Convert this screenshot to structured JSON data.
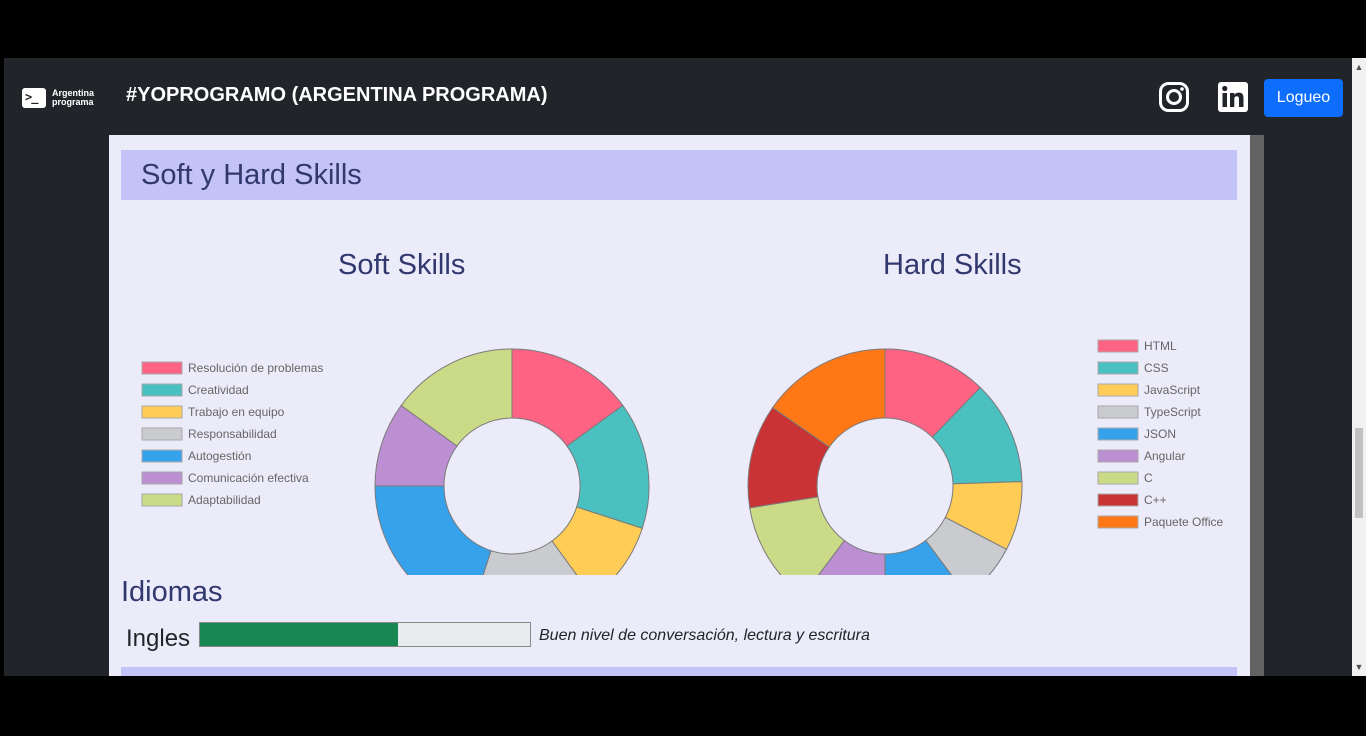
{
  "app": {
    "logo_text_line1": "Argentina",
    "logo_text_line2": "programa",
    "logo_symbol": ">_",
    "title": "#YOPROGRAMO (ARGENTINA PROGRAMA)",
    "login_label": "Logueo",
    "icons": [
      "instagram-icon",
      "linkedin-icon"
    ]
  },
  "section": {
    "title": "Soft y Hard Skills"
  },
  "chart_data": [
    {
      "type": "pie",
      "variant": "doughnut",
      "title": "Soft Skills",
      "legend_position": "left",
      "labels": [
        "Resolución de problemas",
        "Creatividad",
        "Trabajo en equipo",
        "Responsabilidad",
        "Autogestión",
        "Comunicación efectiva",
        "Adaptabilidad"
      ],
      "values": [
        15,
        15,
        10,
        15,
        20,
        10,
        15
      ],
      "colors": [
        "#ff6384",
        "#4bc0c0",
        "#ffcd56",
        "#c9cbcf",
        "#36a2eb",
        "#bb8fd1",
        "#cbda87"
      ]
    },
    {
      "type": "pie",
      "variant": "doughnut",
      "title": "Hard Skills",
      "legend_position": "right",
      "labels": [
        "HTML",
        "CSS",
        "JavaScript",
        "TypeScript",
        "JSON",
        "Angular",
        "C",
        "C++",
        "Paquete Office"
      ],
      "values": [
        12,
        12,
        8,
        7,
        10,
        10,
        12,
        12,
        15
      ],
      "colors": [
        "#ff6384",
        "#4bc0c0",
        "#ffcd56",
        "#c9cbcf",
        "#36a2eb",
        "#bb8fd1",
        "#cbda87",
        "#c93336",
        "#ff7815"
      ]
    }
  ],
  "languages": {
    "title": "Idiomas",
    "items": [
      {
        "name": "Ingles",
        "level": 0.6,
        "description": "Buen nivel de conversación, lectura y escritura",
        "color": "#198754"
      }
    ]
  }
}
